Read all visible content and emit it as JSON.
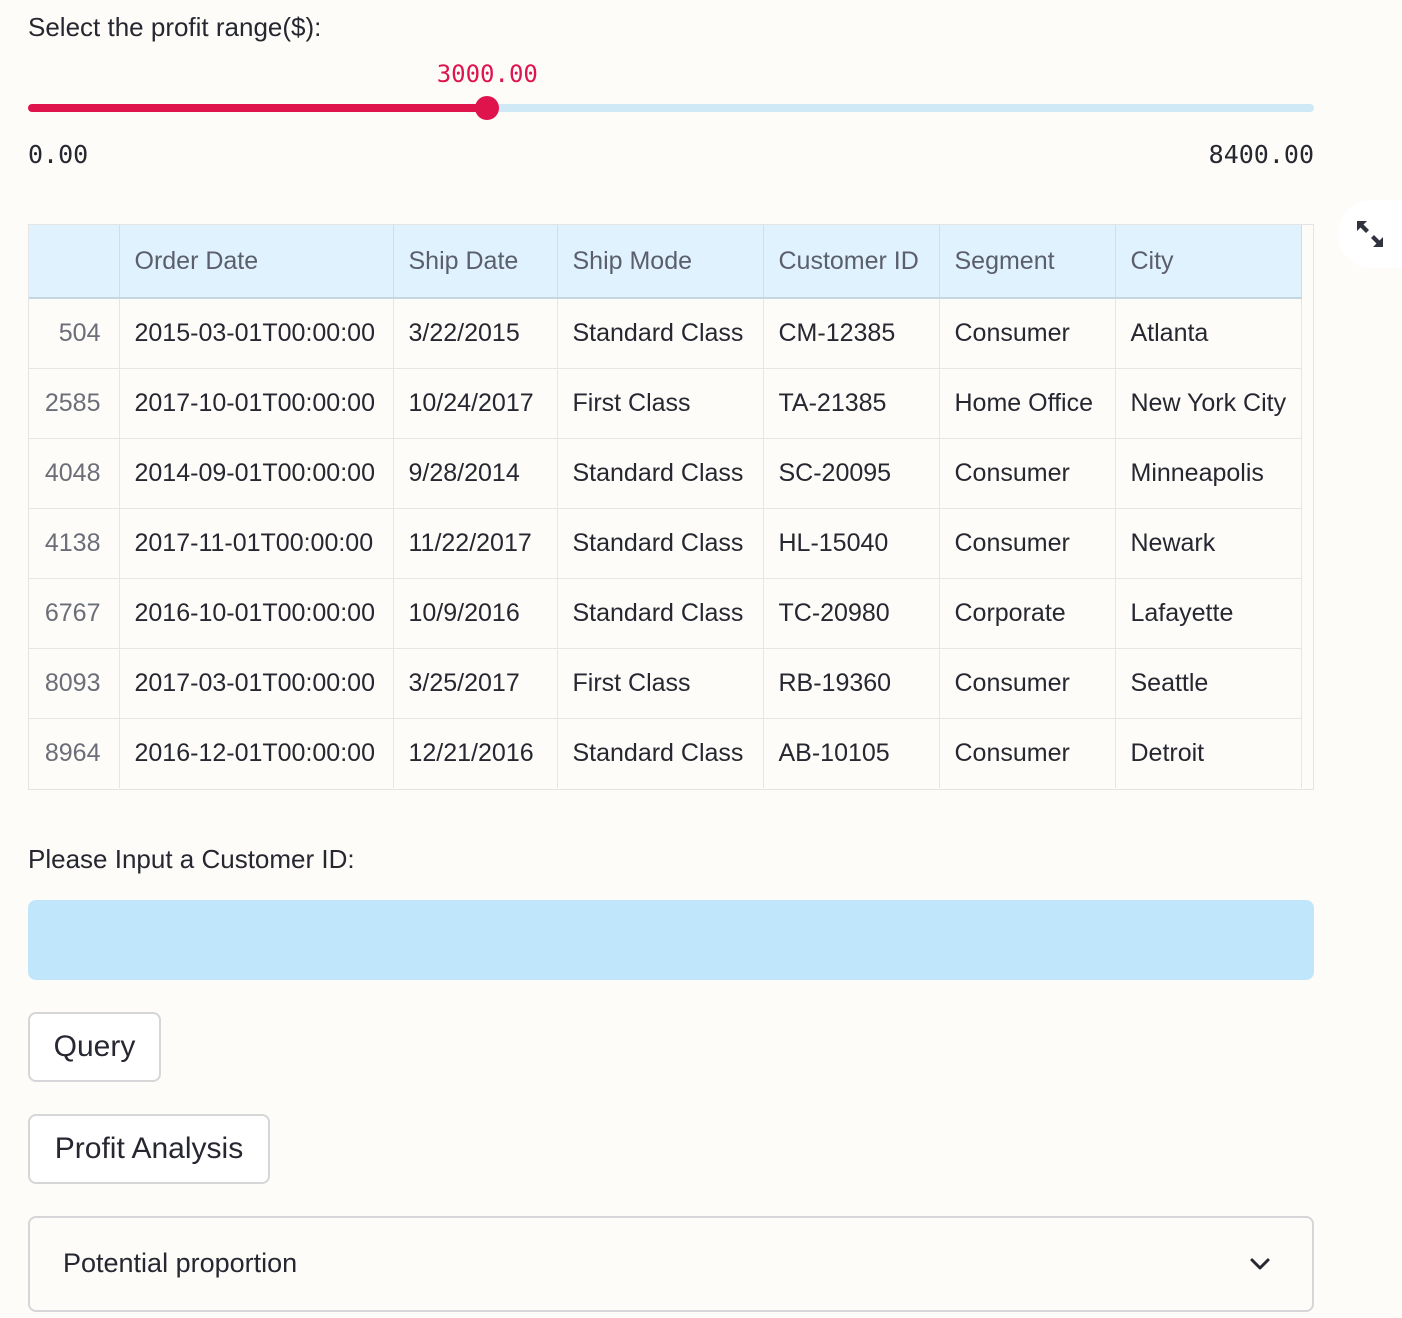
{
  "slider": {
    "label": "Select the profit range($):",
    "value_text": "3000.00",
    "min_text": "0.00",
    "max_text": "8400.00",
    "value": 3000,
    "min": 0,
    "max": 8400,
    "accent_color": "#e0144c"
  },
  "table": {
    "columns": [
      "",
      "Order Date",
      "Ship Date",
      "Ship Mode",
      "Customer ID",
      "Segment",
      "City"
    ],
    "rows": [
      [
        "504",
        "2015-03-01T00:00:00",
        "3/22/2015",
        "Standard Class",
        "CM-12385",
        "Consumer",
        "Atlanta"
      ],
      [
        "2585",
        "2017-10-01T00:00:00",
        "10/24/2017",
        "First Class",
        "TA-21385",
        "Home Office",
        "New York City"
      ],
      [
        "4048",
        "2014-09-01T00:00:00",
        "9/28/2014",
        "Standard Class",
        "SC-20095",
        "Consumer",
        "Minneapolis"
      ],
      [
        "4138",
        "2017-11-01T00:00:00",
        "11/22/2017",
        "Standard Class",
        "HL-15040",
        "Consumer",
        "Newark"
      ],
      [
        "6767",
        "2016-10-01T00:00:00",
        "10/9/2016",
        "Standard Class",
        "TC-20980",
        "Corporate",
        "Lafayette"
      ],
      [
        "8093",
        "2017-03-01T00:00:00",
        "3/25/2017",
        "First Class",
        "RB-19360",
        "Consumer",
        "Seattle"
      ],
      [
        "8964",
        "2016-12-01T00:00:00",
        "12/21/2016",
        "Standard Class",
        "AB-10105",
        "Consumer",
        "Detroit"
      ]
    ],
    "fullscreen_icon": "expand-arrows-icon"
  },
  "customer_input": {
    "label": "Please Input a Customer ID:",
    "value": "",
    "placeholder": ""
  },
  "buttons": {
    "query_label": "Query",
    "profit_analysis_label": "Profit Analysis"
  },
  "expander": {
    "label": "Potential proportion",
    "icon": "chevron-down-icon"
  }
}
